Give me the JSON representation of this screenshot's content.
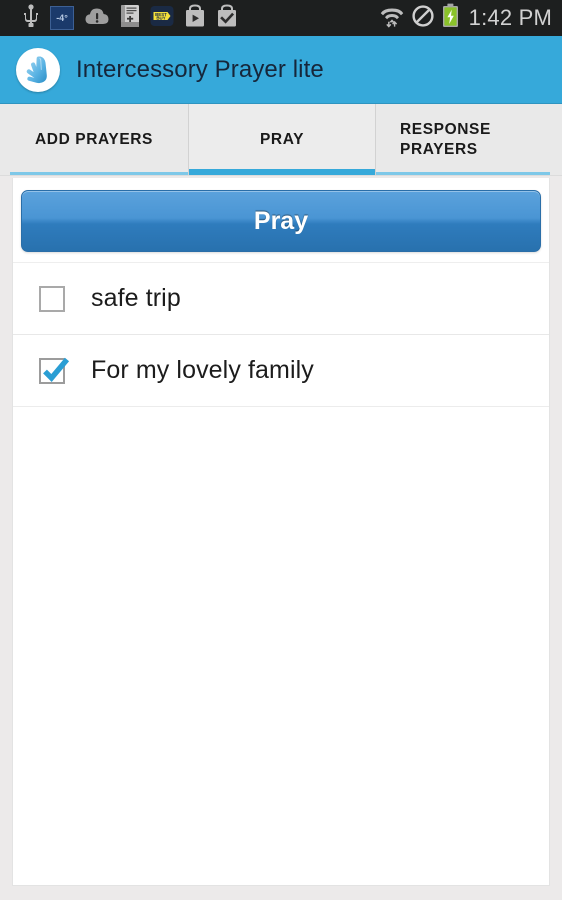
{
  "status_bar": {
    "icons_left": [
      {
        "name": "usb-icon",
        "label": "USB"
      },
      {
        "name": "weather-temp-icon",
        "label": "-4°"
      },
      {
        "name": "cloud-alert-icon",
        "label": "Alert"
      },
      {
        "name": "holy-bible-app-icon",
        "label": "HOLY BIBLE"
      },
      {
        "name": "best-buy-app-icon",
        "label": "BEST BUY"
      },
      {
        "name": "play-store-download-icon",
        "label": "Play Store"
      },
      {
        "name": "app-installed-icon",
        "label": "Installed"
      }
    ],
    "icons_right": [
      {
        "name": "wifi-icon",
        "label": "Wi-Fi"
      },
      {
        "name": "mute-icon",
        "label": "Silent"
      },
      {
        "name": "battery-charging-icon",
        "label": "Charging"
      }
    ],
    "clock": "1:42 PM"
  },
  "app_bar": {
    "logo_name": "praying-hands-logo",
    "title": "Intercessory Prayer lite",
    "background_color": "#36a9da"
  },
  "tabs": {
    "active_index": 1,
    "items": [
      {
        "label": "ADD PRAYERS"
      },
      {
        "label": "PRAY"
      },
      {
        "label": "RESPONSE PRAYERS"
      }
    ],
    "active_underline_color": "#36a9da",
    "inactive_underline_color": "#7ec8e8"
  },
  "main": {
    "pray_button_label": "Pray",
    "prayers": [
      {
        "text": "safe trip",
        "checked": false
      },
      {
        "text": "For my lovely family",
        "checked": true
      }
    ],
    "checkbox_checked_color": "#2a9ed4"
  }
}
